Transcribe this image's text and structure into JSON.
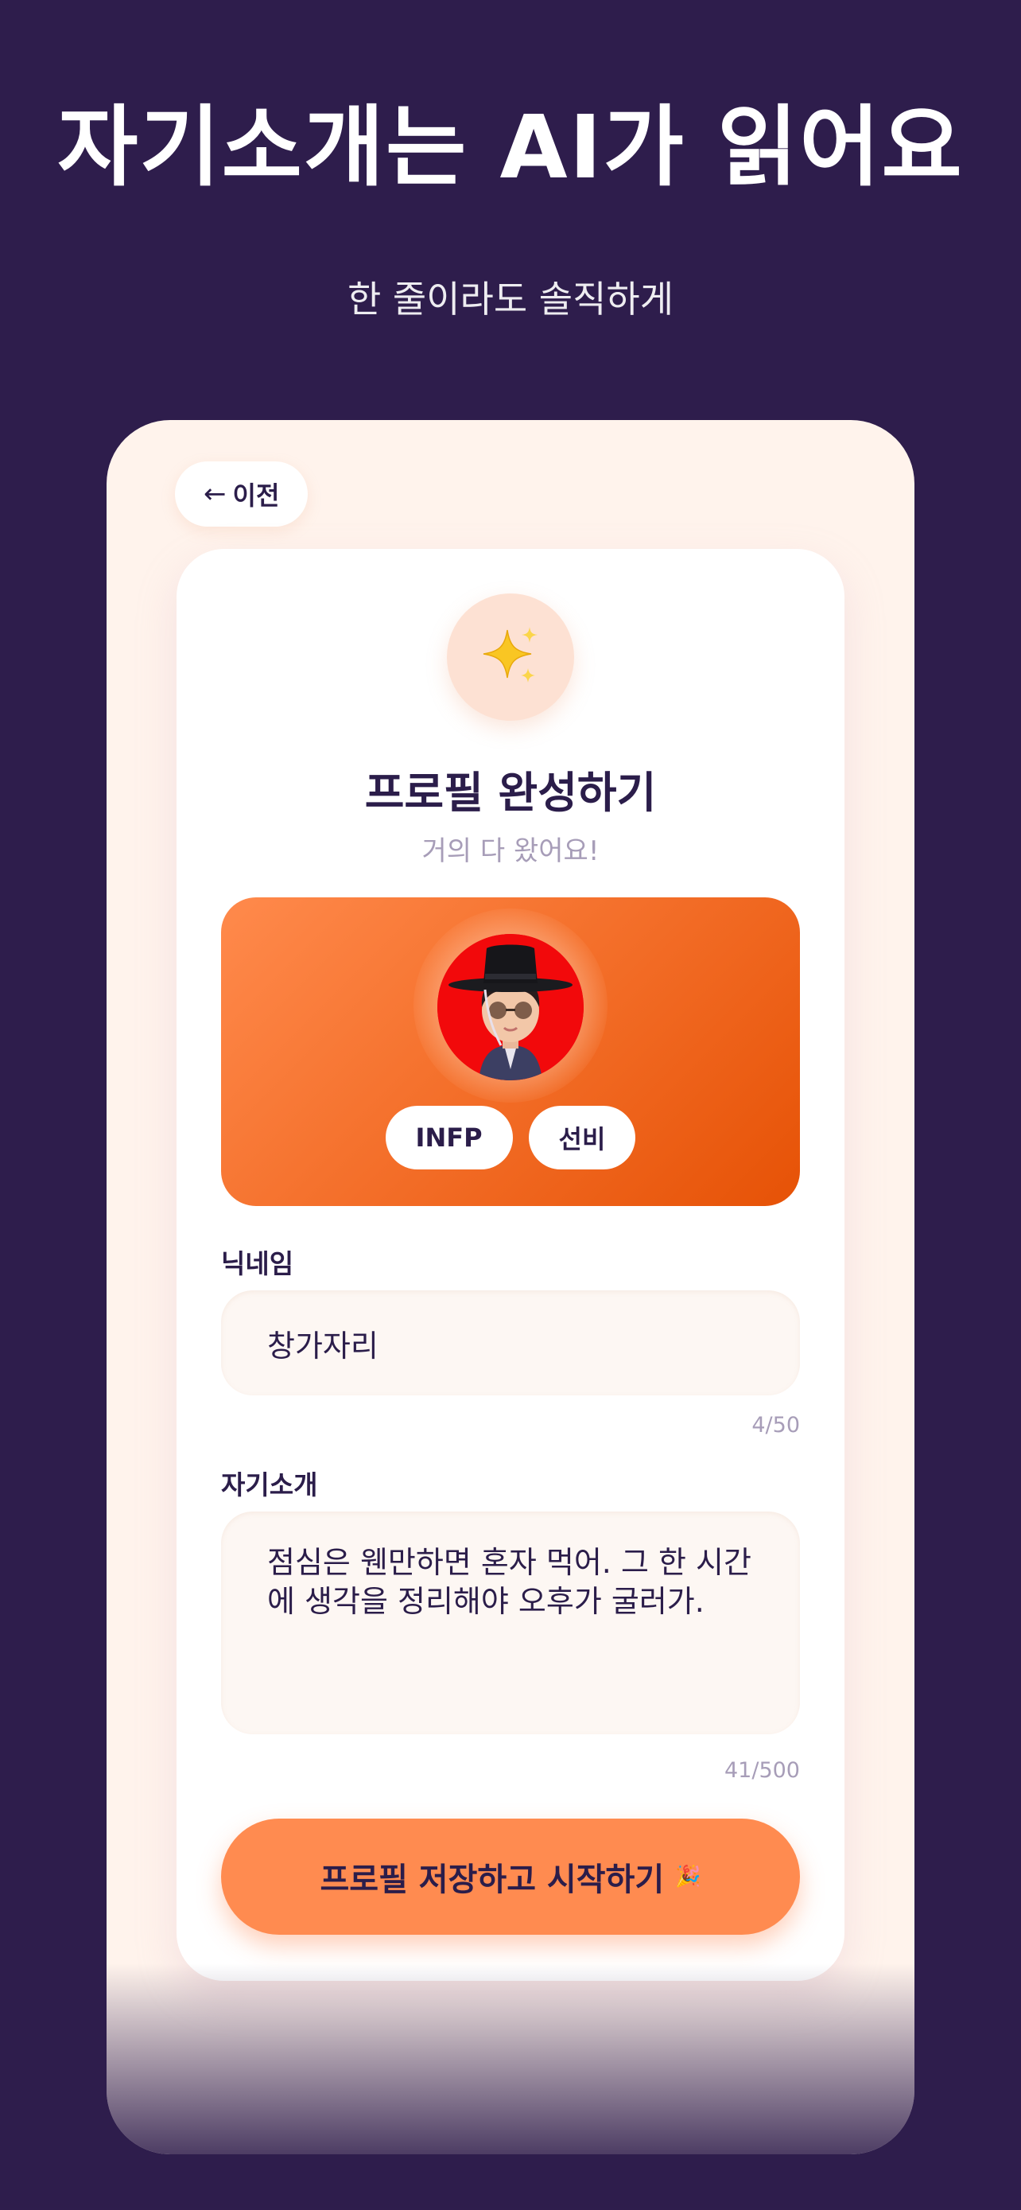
{
  "promo": {
    "title": "자기소개는 AI가 읽어요",
    "subtitle": "한 줄이라도 솔직하게"
  },
  "nav": {
    "back_icon": "←",
    "back_label": "이전"
  },
  "header": {
    "icon": "sparkles-icon",
    "title": "프로필 완성하기",
    "subtitle": "거의 다 왔어요!"
  },
  "profile": {
    "mbti": "INFP",
    "character": "선비"
  },
  "form": {
    "nickname": {
      "label": "닉네임",
      "value": "창가자리",
      "counter": "4/50"
    },
    "bio": {
      "label": "자기소개",
      "value": "점심은 웬만하면 혼자 먹어. 그 한 시간에 생각을 정리해야 오후가 굴러가.",
      "counter": "41/500"
    }
  },
  "submit": {
    "label": "프로필 저장하고 시작하기",
    "icon": "🎉"
  },
  "colors": {
    "background": "#2e1d4c",
    "accent": "#ff8b50",
    "text": "#2b1d4a",
    "muted": "#a79db8"
  }
}
